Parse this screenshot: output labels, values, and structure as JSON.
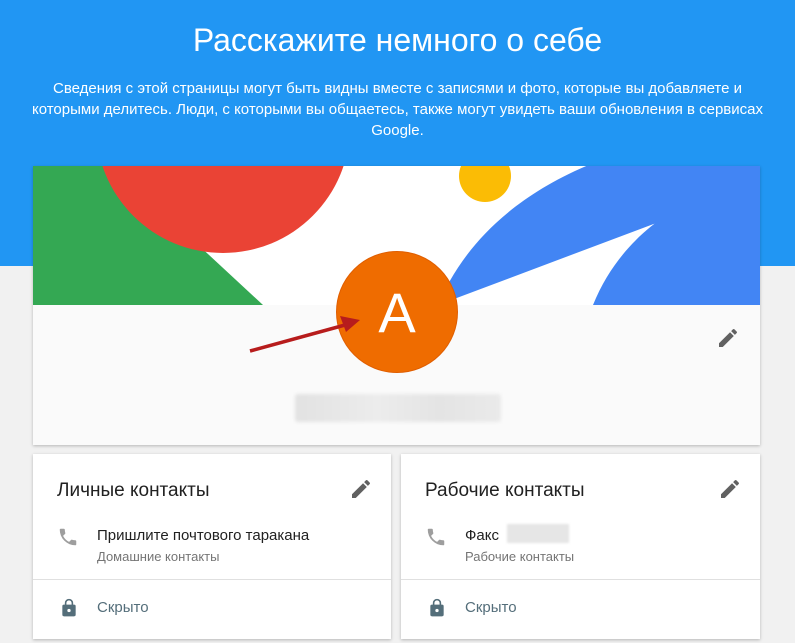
{
  "header": {
    "title": "Расскажите немного о себе",
    "subtitle": "Сведения с этой страницы могут быть видны вместе с записями и фото, которые вы добавляете и которыми делитесь. Люди, с которыми вы общаетесь, также могут увидеть ваши обновления в сервисах Google."
  },
  "profile": {
    "avatar_letter": "A",
    "edit_icon": "pencil-icon",
    "name_redacted": true
  },
  "personal_contacts": {
    "title": "Личные контакты",
    "edit_icon": "pencil-icon",
    "item_icon": "phone-icon",
    "value": "Пришлите почтового таракана",
    "label": "Домашние контакты",
    "visibility_icon": "lock-icon",
    "visibility": "Скрыто"
  },
  "work_contacts": {
    "title": "Рабочие контакты",
    "edit_icon": "pencil-icon",
    "item_icon": "phone-icon",
    "value": "Факс",
    "label": "Рабочие контакты",
    "visibility_icon": "lock-icon",
    "visibility": "Скрыто"
  },
  "colors": {
    "header_blue": "#2196f3",
    "avatar_orange": "#ef6c00",
    "google_red": "#ea4335",
    "google_green": "#34a853",
    "google_blue": "#4285f4",
    "google_yellow": "#fbbc05",
    "arrow": "#b71c1c"
  }
}
